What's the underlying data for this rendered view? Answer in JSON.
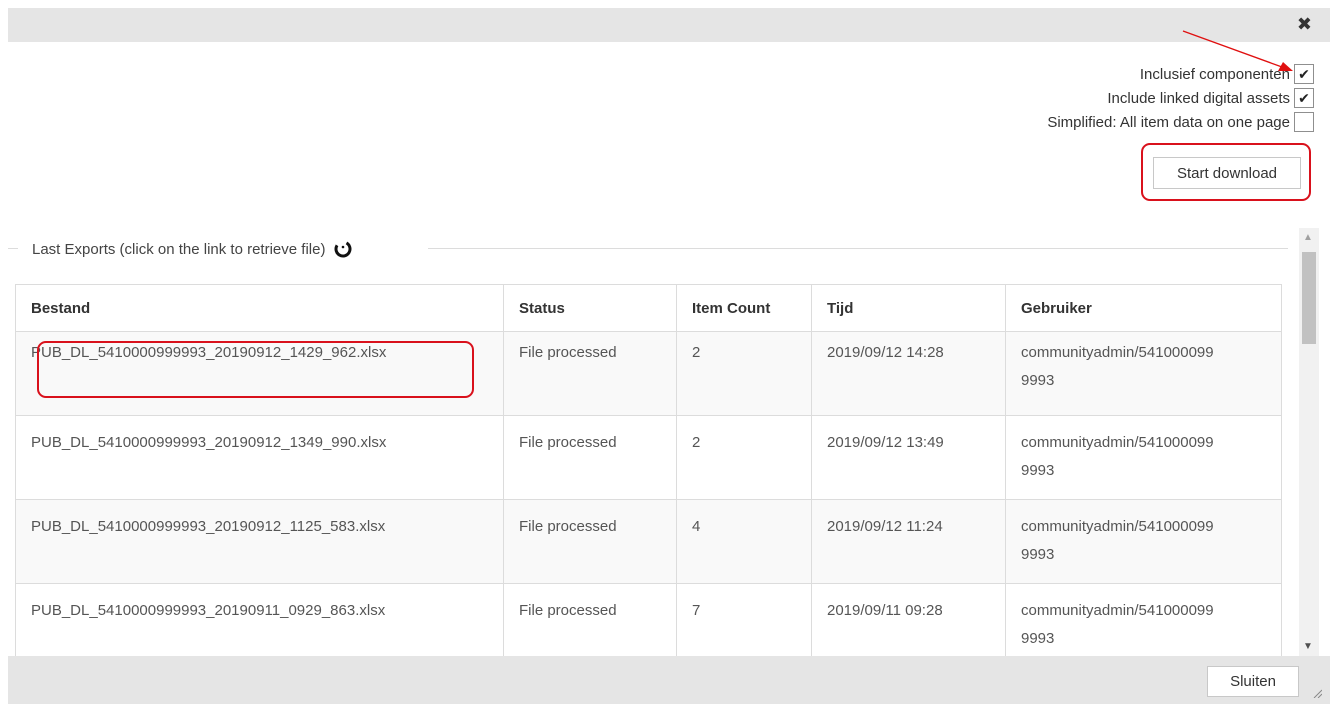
{
  "dialog": {
    "close_icon": "close-icon",
    "options": [
      {
        "label": "Inclusief componenten",
        "checked": true
      },
      {
        "label": "Include linked digital assets",
        "checked": true
      },
      {
        "label": "Simplified: All item data on one page",
        "checked": false
      }
    ],
    "start_download_label": "Start download",
    "check_glyph": "✔"
  },
  "exports": {
    "legend": "Last Exports (click on the link to retrieve file)",
    "spinner_icon": "loading-spinner-icon",
    "columns": [
      "Bestand",
      "Status",
      "Item Count",
      "Tijd",
      "Gebruiker"
    ],
    "rows": [
      {
        "file": "PUB_DL_5410000999993_20190912_1429_962.xlsx",
        "status": "File processed",
        "count": "2",
        "time": "2019/09/12 14:28",
        "user": "communityadmin/5410000999993"
      },
      {
        "file": "PUB_DL_5410000999993_20190912_1349_990.xlsx",
        "status": "File processed",
        "count": "2",
        "time": "2019/09/12 13:49",
        "user": "communityadmin/5410000999993"
      },
      {
        "file": "PUB_DL_5410000999993_20190912_1125_583.xlsx",
        "status": "File processed",
        "count": "4",
        "time": "2019/09/12 11:24",
        "user": "communityadmin/5410000999993"
      },
      {
        "file": "PUB_DL_5410000999993_20190911_0929_863.xlsx",
        "status": "File processed",
        "count": "7",
        "time": "2019/09/11 09:28",
        "user": "communityadmin/5410000999993"
      }
    ]
  },
  "footer": {
    "close_label": "Sluiten"
  },
  "colors": {
    "highlight": "#d9111c",
    "bar": "#e5e5e5"
  }
}
